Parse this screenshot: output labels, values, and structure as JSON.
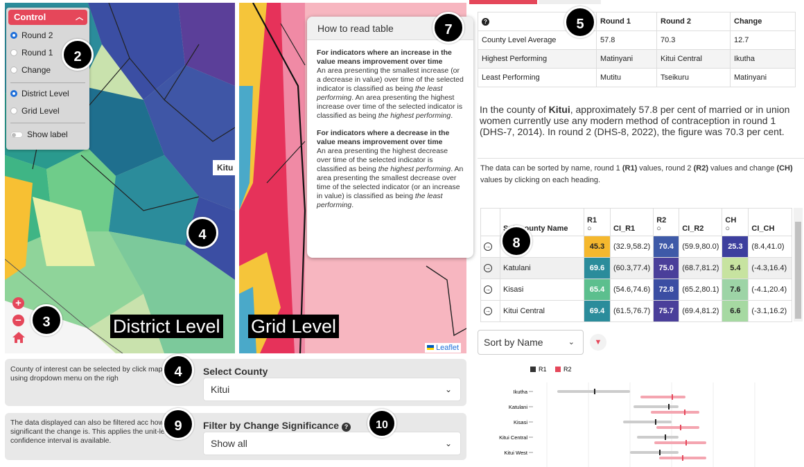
{
  "control": {
    "title": "Control",
    "options": [
      "Round 2",
      "Round 1",
      "Change"
    ],
    "selected": "Round 2",
    "levels": [
      "District Level",
      "Grid Level"
    ],
    "level_selected": "District Level",
    "show_label": "Show label"
  },
  "maps": {
    "left_label": "District Level",
    "right_label": "Grid Level",
    "place_label": "Kitu",
    "attribution": "Leaflet"
  },
  "badges": {
    "b2": "2",
    "b3": "3",
    "b4a": "4",
    "b4b": "4",
    "b5": "5",
    "b7": "7",
    "b8": "8",
    "b9": "9",
    "b10": "10"
  },
  "howto": {
    "title": "How to read table",
    "h1": "For indicators where an increase in the value means improvement over time",
    "p1a": "An area presenting the smallest increase (or a decrease in value) over time of the selected indicator is classified as being ",
    "p1b": "the least performing",
    "p1c": ". An area presenting the highest increase over time of the selected indicator is classified as being ",
    "p1d": "the highest performing",
    "p1e": ".",
    "h2": "For indicators where a decrease in the value means improvement over time",
    "p2a": "An area presenting the highest decrease over time of the selected indicator is classified as being ",
    "p2b": "the highest performing",
    "p2c": ". An area presenting the smallest decrease over time of the selected indicator (or an increase in value) is classified as being ",
    "p2d": "the least performing",
    "p2e": "."
  },
  "compare": {
    "headers": [
      "",
      "Round 1",
      "Round 2",
      "Change"
    ],
    "rows": [
      [
        "County Level Average",
        "57.8",
        "70.3",
        "12.7"
      ],
      [
        "Highest Performing",
        "Matinyani",
        "Kitui Central",
        "Ikutha"
      ],
      [
        "Least Performing",
        "Mutitu",
        "Tseikuru",
        "Matinyani"
      ]
    ]
  },
  "summary": {
    "pre": "In the county of ",
    "county": "Kitui",
    "post": ", approximately 57.8 per cent of married or in union women currently use any modern method of contraception in round 1 (DHS-7, 2014). In round 2 (DHS-8, 2022), the figure was 70.3 per cent."
  },
  "sortnote": {
    "a": "The data can be sorted by name, round 1 ",
    "b": "(R1)",
    "c": " values, round 2 ",
    "d": "(R2)",
    "e": " values and change ",
    "f": "(CH)",
    "g": " values by clicking on each heading."
  },
  "subtable": {
    "headers": [
      "Sub-county Name",
      "R1",
      "CI_R1",
      "R2",
      "CI_R2",
      "CH",
      "CI_CH"
    ],
    "rows": [
      {
        "name": "",
        "r1": "45.3",
        "ci1": "(32.9,58.2)",
        "r2": "70.4",
        "ci2": "(59.9,80.0)",
        "ch": "25.3",
        "cich": "(8.4,41.0)",
        "c1": "#f5b82e",
        "c2": "#3e5aa8",
        "c3": "#3d3f9e"
      },
      {
        "name": "Katulani",
        "r1": "69.6",
        "ci1": "(60.3,77.4)",
        "r2": "75.0",
        "ci2": "(68.7,81.2)",
        "ch": "5.4",
        "cich": "(-4.3,16.4)",
        "c1": "#2b8c9b",
        "c2": "#4a3f9a",
        "c3": "#c7e3a0"
      },
      {
        "name": "Kisasi",
        "r1": "65.4",
        "ci1": "(54.6,74.6)",
        "r2": "72.8",
        "ci2": "(65.2,80.1)",
        "ch": "7.6",
        "cich": "(-4.1,20.4)",
        "c1": "#5cbf8e",
        "c2": "#3b4ea3",
        "c3": "#9dd4a6"
      },
      {
        "name": "Kitui Central",
        "r1": "69.4",
        "ci1": "(61.5,76.7)",
        "r2": "75.7",
        "ci2": "(69.4,81.2)",
        "ch": "6.6",
        "cich": "(-3.1,16.2)",
        "c1": "#2b8c9b",
        "c2": "#4a3f9a",
        "c3": "#a6d9a2"
      }
    ]
  },
  "sort": {
    "value": "Sort by Name"
  },
  "forest": {
    "legend": [
      "R1",
      "R2"
    ],
    "rows": [
      "Ikutha",
      "Katulani",
      "Kisasi",
      "Kitui Central",
      "Kitui West"
    ]
  },
  "county_panel": {
    "text": "County of interest can be selected by click map or using dropdown menu on the righ",
    "title": "Select County",
    "value": "Kitui"
  },
  "filter_panel": {
    "text": "The data displayed can also be filtered acc how significant the change is. This applies the unit-level confidence interval is available.",
    "title": "Filter by Change Significance",
    "value": "Show all"
  }
}
